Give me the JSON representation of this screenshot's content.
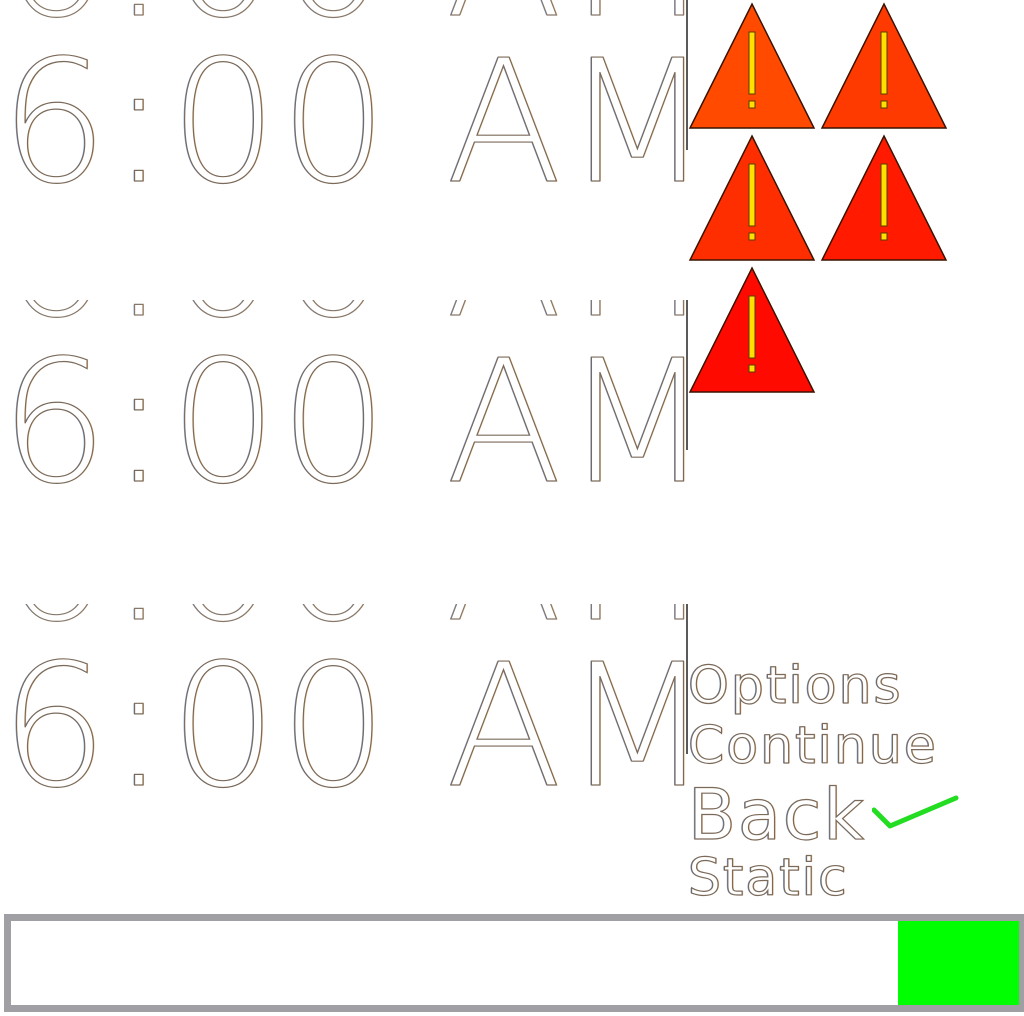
{
  "clocks": [
    {
      "time": "6:00",
      "meridiem": "AM"
    },
    {
      "time": "6:00",
      "meridiem": "AM"
    },
    {
      "time": "6:00",
      "meridiem": "AM"
    }
  ],
  "warnings": {
    "count": 5,
    "icon": "warning-triangle-icon",
    "glyph": "!",
    "colors": [
      "#ff4a00",
      "#ff3a00",
      "#ff2e00",
      "#ff1a00",
      "#ff0a00"
    ]
  },
  "menu": {
    "items": [
      {
        "label": "Options"
      },
      {
        "label": "Continue"
      },
      {
        "label": "Back"
      },
      {
        "label": "Static"
      }
    ],
    "selected_icon": "checkmark-icon"
  },
  "progress": {
    "value": 0.12,
    "fill_color": "#00ff00",
    "track_color": "#a0a0a4"
  }
}
